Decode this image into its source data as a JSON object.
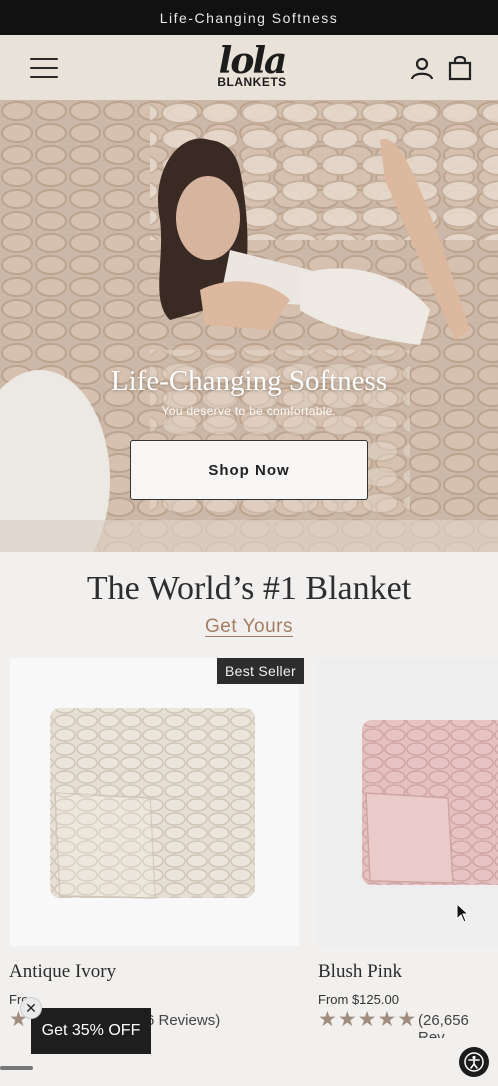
{
  "announcement": "Life-Changing Softness",
  "logo": {
    "main": "lola",
    "sub": "BLANKETS"
  },
  "hero": {
    "title": "Life-Changing Softness",
    "subtitle": "You deserve to be comfortable.",
    "cta": "Shop Now"
  },
  "section": {
    "title": "The World’s #1 Blanket",
    "link": "Get Yours"
  },
  "products": [
    {
      "badge": "Best Seller",
      "name": "Antique Ivory",
      "price": "Fro",
      "reviews": "6 Reviews)",
      "color": "#e8e2d8"
    },
    {
      "name": "Blush Pink",
      "price": "From $125.00",
      "reviews": "(26,656 Rev",
      "color": "#e8c5c5"
    }
  ],
  "promo": {
    "label": "Get 35% OFF",
    "close": "✕"
  },
  "colors": {
    "announcement_bg": "#111111",
    "header_bg": "#e8e2d9",
    "link": "#a67c62",
    "stars": "#a08d80"
  }
}
